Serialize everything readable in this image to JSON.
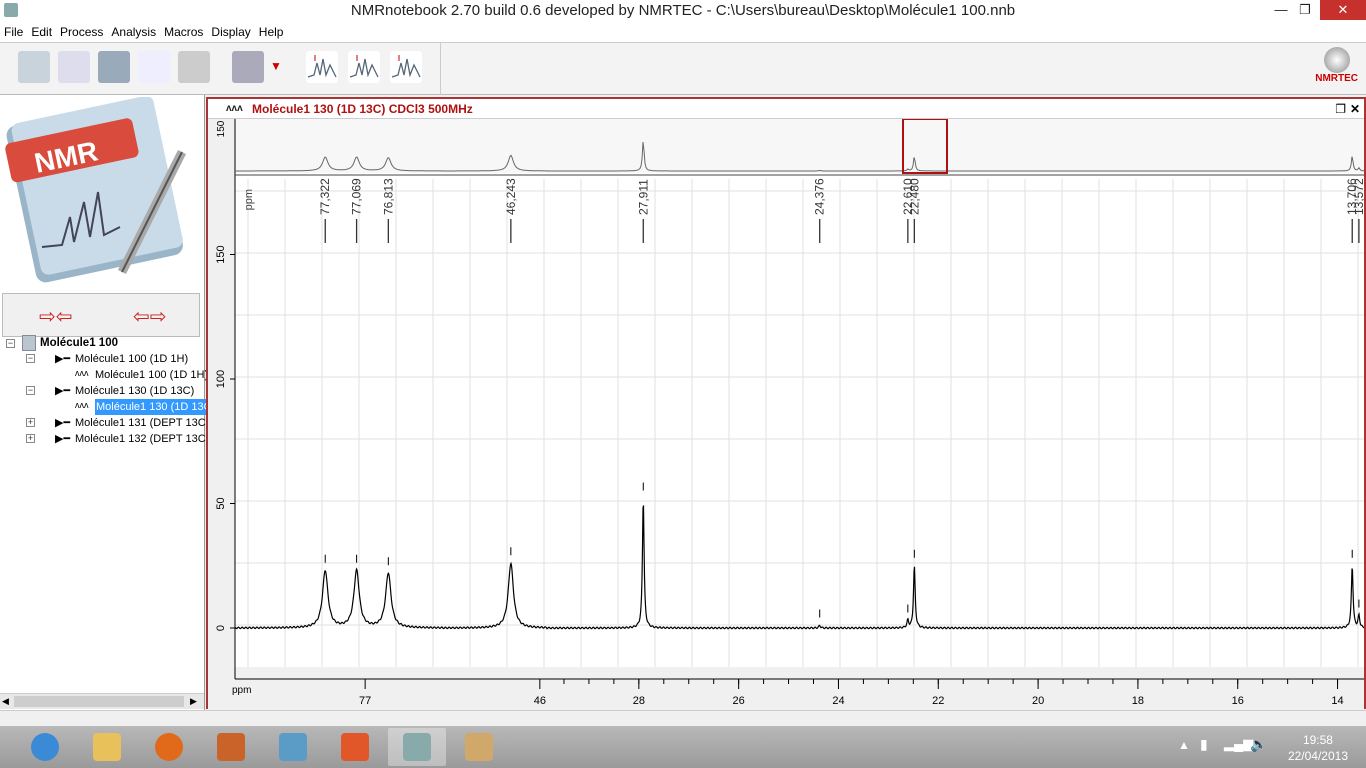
{
  "window": {
    "title": "NMRnotebook 2.70  build 0.6 developed by NMRTEC - C:\\Users\\bureau\\Desktop\\Molécule1 100.nnb"
  },
  "menu": [
    "File",
    "Edit",
    "Process",
    "Analysis",
    "Macros",
    "Display",
    "Help"
  ],
  "toolbar": {
    "icons": [
      "notebook-icon",
      "import-spectrum-icon",
      "library-icon",
      "report-icon",
      "print-icon",
      "settings-gears-icon",
      "dropdown-arrow-icon",
      "phase-icon",
      "peak-picking-icon",
      "integration-icon"
    ],
    "brand": "NMRTEC"
  },
  "logo": {
    "text": "NMR"
  },
  "tree": {
    "root": "Molécule1 100",
    "items": [
      {
        "label": "Molécule1 100 (1D 1H)",
        "level": 1,
        "expander": "−"
      },
      {
        "label": "Molécule1 100 (1D 1H)",
        "level": 2
      },
      {
        "label": "Molécule1 130 (1D 13C)",
        "level": 1,
        "expander": "−"
      },
      {
        "label": "Molécule1 130 (1D 13C)",
        "level": 2,
        "selected": true
      },
      {
        "label": "Molécule1 131 (DEPT 13C)",
        "level": 1,
        "expander": "+"
      },
      {
        "label": "Molécule1 132 (DEPT 13C)",
        "level": 1,
        "expander": "+"
      }
    ]
  },
  "spectrum": {
    "title": "Molécule1 130 (1D 13C) CDCl3 500MHz",
    "accent": "#b01010"
  },
  "chart_data": {
    "type": "line",
    "xlabel": "ppm",
    "x_segments": [
      [
        78.05,
        76.38
      ],
      [
        46.82,
        45.94
      ],
      [
        29.84,
        13.47
      ]
    ],
    "x_ticks": [
      "77",
      "46",
      "28",
      "26",
      "24",
      "22",
      "20",
      "18",
      "16",
      "14"
    ],
    "y_ticks": [
      "0",
      "50",
      "100",
      "150"
    ],
    "overview_y_tick": "150",
    "ylim": [
      -20,
      178
    ],
    "peaks": [
      {
        "ppm": 77.322,
        "label": "77,322",
        "height": 23
      },
      {
        "ppm": 77.069,
        "label": "77,069",
        "height": 23
      },
      {
        "ppm": 76.813,
        "label": "76,813",
        "height": 22
      },
      {
        "ppm": 46.243,
        "label": "46,243",
        "height": 26
      },
      {
        "ppm": 27.911,
        "label": "27,911",
        "height": 52
      },
      {
        "ppm": 24.376,
        "label": "24,376",
        "height": 1
      },
      {
        "ppm": 22.61,
        "label": "22,610",
        "height": 3
      },
      {
        "ppm": 22.48,
        "label": "22,480",
        "height": 25
      },
      {
        "ppm": 13.706,
        "label": "13,706",
        "height": 25
      },
      {
        "ppm": 13.572,
        "label": "13,572",
        "height": 5
      }
    ]
  },
  "taskbar": {
    "apps": [
      "internet-explorer",
      "file-explorer",
      "firefox",
      "office",
      "photos",
      "pdf",
      "nmrnotebook",
      "paint"
    ],
    "time": "19:58",
    "date": "22/04/2013"
  }
}
